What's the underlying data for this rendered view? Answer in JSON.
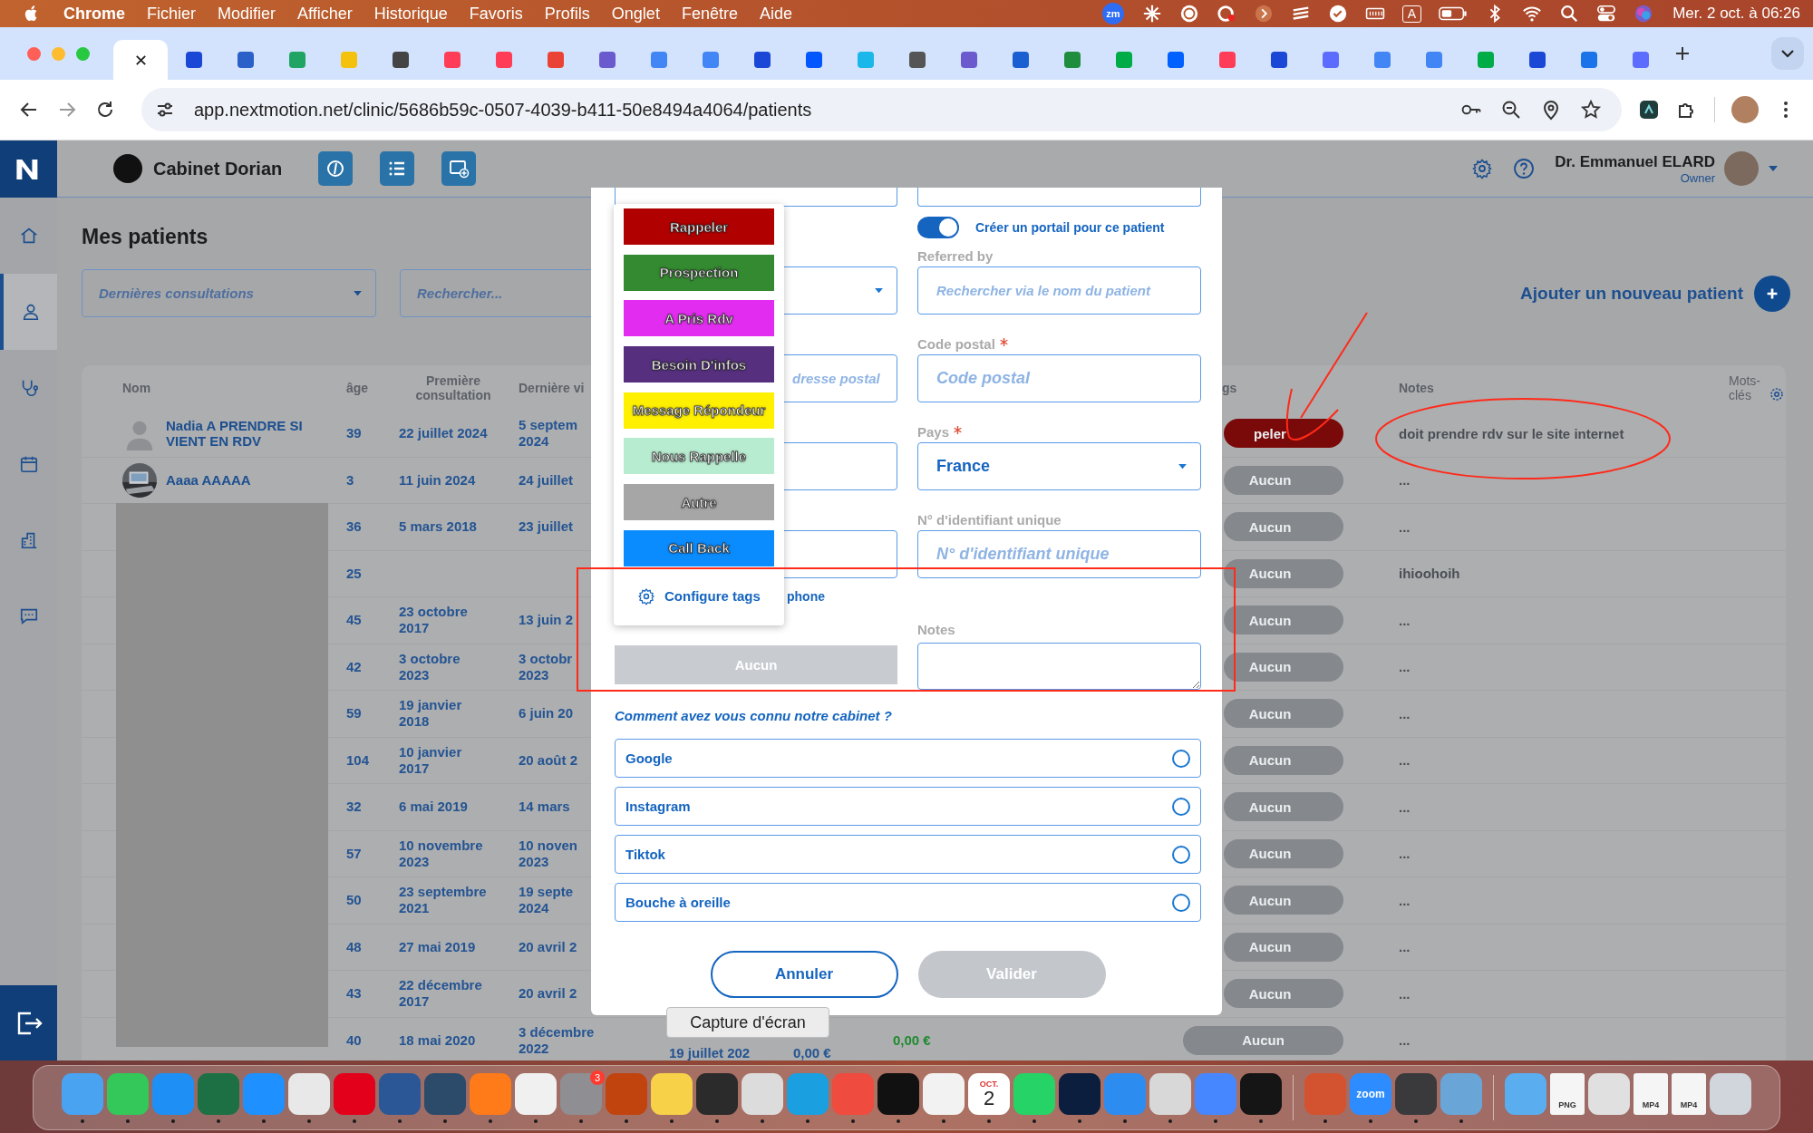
{
  "menu_bar": {
    "app": "Chrome",
    "menus": [
      "Fichier",
      "Modifier",
      "Afficher",
      "Historique",
      "Favoris",
      "Profils",
      "Onglet",
      "Fenêtre",
      "Aide"
    ],
    "status": {
      "zm": "zm",
      "input_source": "A",
      "clock": "Mer. 2 oct. à 06:26"
    }
  },
  "browser": {
    "tabs": [
      {
        "selected": true
      },
      {
        "selected": false,
        "color": "#1a47d6"
      },
      {
        "selected": false,
        "color": "#2a60c8"
      },
      {
        "selected": false,
        "color": "#1fa463"
      },
      {
        "selected": false,
        "color": "#f4c20d"
      },
      {
        "selected": false,
        "color": "#444444"
      },
      {
        "selected": false,
        "color": "#ff3d57"
      },
      {
        "selected": false,
        "color": "#ff3d57"
      },
      {
        "selected": false,
        "color": "#ea4335"
      },
      {
        "selected": false,
        "color": "#6a5acd"
      },
      {
        "selected": false,
        "color": "#4285f4"
      },
      {
        "selected": false,
        "color": "#4285f4"
      },
      {
        "selected": false,
        "color": "#1a47d6"
      },
      {
        "selected": false,
        "color": "#0057ff"
      },
      {
        "selected": false,
        "color": "#1ab7ea"
      },
      {
        "selected": false,
        "color": "#555555"
      },
      {
        "selected": false,
        "color": "#6a5acd"
      },
      {
        "selected": false,
        "color": "#1a5fd1"
      },
      {
        "selected": false,
        "color": "#1e8e3e"
      },
      {
        "selected": false,
        "color": "#00ac47"
      },
      {
        "selected": false,
        "color": "#0061ff"
      },
      {
        "selected": false,
        "color": "#ff3d57"
      },
      {
        "selected": false,
        "color": "#1a47d6"
      },
      {
        "selected": false,
        "color": "#5b6cff"
      },
      {
        "selected": false,
        "color": "#4285f4"
      },
      {
        "selected": false,
        "color": "#4285f4"
      },
      {
        "selected": false,
        "color": "#00ac47"
      },
      {
        "selected": false,
        "color": "#1a47d6"
      },
      {
        "selected": false,
        "color": "#1a73e8"
      },
      {
        "selected": false,
        "color": "#5b6cff"
      }
    ],
    "url": "app.nextmotion.net/clinic/5686b59c-0507-4039-b411-50e8494a4064/patients"
  },
  "app": {
    "clinic": "Cabinet Dorian",
    "user": {
      "name": "Dr. Emmanuel ELARD",
      "role": "Owner"
    },
    "sidebar": [
      {
        "kind": "home",
        "selected": false
      },
      {
        "kind": "user",
        "selected": true
      },
      {
        "kind": "stethoscope",
        "selected": false
      },
      {
        "kind": "calendar",
        "selected": false
      },
      {
        "kind": "building",
        "selected": false
      },
      {
        "kind": "chat",
        "selected": false
      }
    ],
    "page_title": "Mes patients",
    "filter": {
      "placeholder": "Dernières consultations"
    },
    "search": {
      "placeholder": "Rechercher..."
    },
    "add_button": "Ajouter un nouveau patient",
    "table": {
      "columns": {
        "name": "Nom",
        "age": "âge",
        "first": "Première consultation",
        "last": "Dernière vi",
        "tags": "gs",
        "notes": "Notes",
        "keywords": "Mots-clés"
      },
      "rows": [
        {
          "name": "Nadia A PRENDRE SI VIENT EN RDV",
          "avatar": {
            "kind": "silhouette"
          },
          "age": "39",
          "first": "22 juillet 2024",
          "last": "5 septem\n2024",
          "tag": {
            "label": "peler",
            "color": "#7a0a0a"
          },
          "notes": "doit prendre rdv sur le site internet"
        },
        {
          "name": "Aaaa AAAAA",
          "age": "3",
          "first": "11 juin 2024",
          "last": "24 juillet",
          "tag": {
            "label": "Aucun",
            "color": "#85888c"
          },
          "notes": "..."
        },
        {
          "age": "36",
          "first": "5 mars 2018",
          "last": "23 juillet",
          "tag": {
            "label": "Aucun",
            "color": "#85888c"
          },
          "notes": "..."
        },
        {
          "age": "25",
          "tag": {
            "label": "Aucun",
            "color": "#85888c"
          },
          "notes": "ihioohoih"
        },
        {
          "age": "45",
          "first": "23 octobre\n2017",
          "last": "13 juin 2",
          "tag": {
            "label": "Aucun",
            "color": "#85888c"
          },
          "notes": "..."
        },
        {
          "age": "42",
          "first": "3 octobre\n2023",
          "last": "3 octobr\n2023",
          "tag": {
            "label": "Aucun",
            "color": "#85888c"
          },
          "notes": "..."
        },
        {
          "age": "59",
          "first": "19 janvier\n2018",
          "last": "6 juin 20",
          "tag": {
            "label": "Aucun",
            "color": "#85888c"
          },
          "notes": "..."
        },
        {
          "age": "104",
          "first": "10 janvier\n2017",
          "last": "20 août 2",
          "tag": {
            "label": "Aucun",
            "color": "#85888c"
          },
          "notes": "..."
        },
        {
          "age": "32",
          "first": "6 mai 2019",
          "last": "14 mars",
          "tag": {
            "label": "Aucun",
            "color": "#85888c"
          },
          "notes": "..."
        },
        {
          "age": "57",
          "first": "10 novembre\n2023",
          "last": "10 noven\n2023",
          "tag": {
            "label": "Aucun",
            "color": "#85888c"
          },
          "notes": "..."
        },
        {
          "age": "50",
          "first": "23 septembre\n2021",
          "last": "19 septe\n2024",
          "tag": {
            "label": "Aucun",
            "color": "#85888c"
          },
          "notes": "..."
        },
        {
          "age": "48",
          "first": "27 mai 2019",
          "last": "20 avril 2",
          "tag": {
            "label": "Aucun",
            "color": "#85888c"
          },
          "notes": "..."
        },
        {
          "age": "43",
          "first": "22 décembre\n2017",
          "last": "20 avril 2",
          "tag": {
            "label": "Aucun",
            "color": "#85888c"
          },
          "notes": "..."
        },
        {
          "age": "40",
          "first": "18 mai 2020",
          "last": "3 décembre\n2022",
          "col_5": "19 juillet 202",
          "col_6": "0,00 €",
          "col_7": "0,00 €",
          "tag": {
            "label": "Aucun",
            "color": "#85888c"
          },
          "notes": "..."
        }
      ]
    }
  },
  "modal": {
    "portal_toggle": {
      "label": "Créer un portail pour ce patient",
      "on": true
    },
    "referred_by": {
      "label": "Referred by",
      "placeholder": "Rechercher via le nom du patient"
    },
    "postal_code": {
      "label": "Code postal",
      "required": true,
      "placeholder": "Code postal"
    },
    "address": {
      "placeholder": "dresse postal"
    },
    "country": {
      "label": "Pays",
      "required": true,
      "value": "France"
    },
    "unique_id": {
      "label": "N° d'identifiant unique",
      "placeholder": "N° d'identifiant unique"
    },
    "phone_label": "phone",
    "tags_button": "Aucun",
    "notes": {
      "label": "Notes"
    },
    "source_question": "Comment avez vous connu notre cabinet ?",
    "sources": [
      {
        "label": "Google",
        "selected": false
      },
      {
        "label": "Instagram",
        "selected": false
      },
      {
        "label": "Tiktok",
        "selected": false
      },
      {
        "label": "Bouche à oreille",
        "selected": false
      }
    ],
    "cancel": "Annuler",
    "submit": {
      "label": "Valider",
      "disabled": true
    }
  },
  "tag_menu": {
    "items": [
      {
        "label": "Rappeler",
        "color": "#b00000"
      },
      {
        "label": "Prospection",
        "color": "#348a30"
      },
      {
        "label": "A Pris Rdv",
        "color": "#e22df0"
      },
      {
        "label": "Besoin D'infos",
        "color": "#56307e"
      },
      {
        "label": "Message Répondeur",
        "color": "#fff000"
      },
      {
        "label": "Nous Rappelle",
        "color": "#b8ecd0"
      },
      {
        "label": "Autre",
        "color": "#a6a6a6"
      },
      {
        "label": "Call Back",
        "color": "#0a8cff"
      }
    ],
    "configure": "Configure tags"
  },
  "tooltip": "Capture d'écran",
  "dock": [
    {
      "kind": "app",
      "color": "#4aa3f0",
      "running": true
    },
    {
      "kind": "app",
      "color": "#34c759",
      "running": true
    },
    {
      "kind": "app",
      "color": "#1e8ff5",
      "running": true
    },
    {
      "kind": "app",
      "color": "#1d7044",
      "running": true
    },
    {
      "kind": "app",
      "color": "#1e90ff",
      "running": true
    },
    {
      "kind": "app",
      "color": "#e8e8e8",
      "running": true
    },
    {
      "kind": "app",
      "color": "#e3001b",
      "running": true
    },
    {
      "kind": "app",
      "color": "#2b5797",
      "running": true
    },
    {
      "kind": "app",
      "color": "#2c4a6a",
      "running": true
    },
    {
      "kind": "app",
      "color": "#ff7a18",
      "running": true
    },
    {
      "kind": "app",
      "color": "#f0f0f0",
      "running": true
    },
    {
      "kind": "app",
      "color": "#8e8e93",
      "running": true,
      "badge": "3"
    },
    {
      "kind": "app",
      "color": "#c1440e",
      "running": true
    },
    {
      "kind": "app",
      "color": "#f7d147",
      "running": true
    },
    {
      "kind": "app",
      "color": "#2b2b2b",
      "running": true
    },
    {
      "kind": "app",
      "color": "#dcdcdc",
      "running": true
    },
    {
      "kind": "app",
      "color": "#1a9fe0",
      "running": true
    },
    {
      "kind": "app",
      "color": "#ef4b3f",
      "running": true
    },
    {
      "kind": "app",
      "color": "#111111",
      "running": true
    },
    {
      "kind": "app",
      "color": "#f2f2f2",
      "running": true
    },
    {
      "kind": "calendar",
      "color": "#ffffff",
      "running": true,
      "month": "OCT.",
      "day": "2"
    },
    {
      "kind": "app",
      "color": "#25d366",
      "running": true
    },
    {
      "kind": "app",
      "color": "#0b1e3d",
      "running": true
    },
    {
      "kind": "app",
      "color": "#2d8cf0",
      "running": true
    },
    {
      "kind": "app",
      "color": "#d8d8d8",
      "running": true
    },
    {
      "kind": "app",
      "color": "#4687ff",
      "running": true
    },
    {
      "kind": "app",
      "color": "#151515",
      "running": true
    },
    {
      "kind": "separator"
    },
    {
      "kind": "app",
      "color": "#d35230",
      "running": true
    },
    {
      "kind": "label",
      "color": "#2d8cff",
      "running": true,
      "text": "zoom"
    },
    {
      "kind": "app",
      "color": "#3a3a3c",
      "running": true
    },
    {
      "kind": "app",
      "color": "#6aa5d8",
      "running": true
    },
    {
      "kind": "separator"
    },
    {
      "kind": "app",
      "color": "#5aaef0",
      "running": false
    },
    {
      "kind": "file",
      "color": "#f5f5f5",
      "running": false,
      "text": "PNG"
    },
    {
      "kind": "app",
      "color": "#e0e0e0",
      "running": false
    },
    {
      "kind": "file",
      "color": "#f5f5f5",
      "running": false,
      "text": "MP4"
    },
    {
      "kind": "file",
      "color": "#f5f5f5",
      "running": false,
      "text": "MP4"
    },
    {
      "kind": "app",
      "color": "#d0d6dc",
      "running": false
    }
  ]
}
